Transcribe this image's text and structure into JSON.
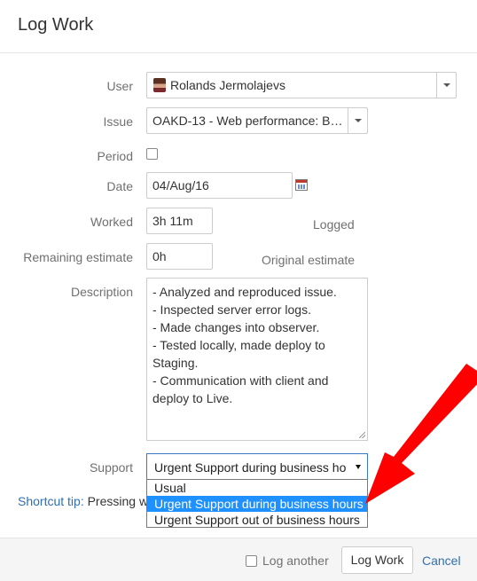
{
  "dialog": {
    "title": "Log Work"
  },
  "form": {
    "user": {
      "label": "User",
      "value": "Rolands Jermolajevs"
    },
    "issue": {
      "label": "Issue",
      "value": "OAKD-13 - Web performance: B…"
    },
    "period": {
      "label": "Period",
      "checked": false
    },
    "date": {
      "label": "Date",
      "value": "04/Aug/16"
    },
    "worked": {
      "label": "Worked",
      "value": "3h 11m",
      "side_label": "Logged"
    },
    "remaining": {
      "label": "Remaining estimate",
      "value": "0h",
      "side_label": "Original estimate"
    },
    "description": {
      "label": "Description",
      "lines": [
        "- Analyzed and reproduced issue.",
        "- Inspected server error logs.",
        "- Made changes into observer.",
        "- Tested locally, made deploy to",
        "Staging.",
        "- Communication with client and",
        "deploy to Live."
      ]
    },
    "support": {
      "label": "Support",
      "selected": "Urgent Support during business ho",
      "options": [
        "Usual",
        "Urgent Support during business hours",
        "Urgent Support out of business hours"
      ],
      "highlighted_index": 1
    }
  },
  "shortcut_tip": {
    "label": "Shortcut tip:",
    "text": "Pressing w"
  },
  "footer": {
    "log_another_label": "Log another",
    "log_another_checked": false,
    "submit_label": "Log Work",
    "cancel_label": "Cancel"
  },
  "annotation": {
    "arrow_color": "#ff0000"
  }
}
